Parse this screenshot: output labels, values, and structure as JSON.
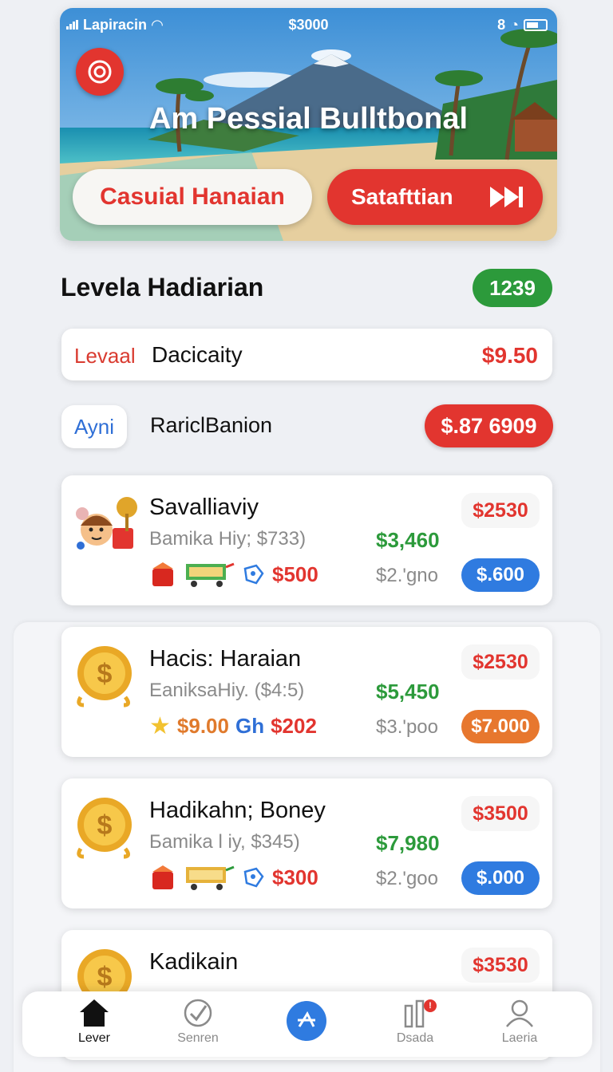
{
  "status_bar": {
    "carrier": "Lapiracin",
    "balance": "$3000",
    "time_prefix": "8"
  },
  "hero": {
    "title": "Am Pessial Bulltbonal",
    "casual_button": "Casuial Hanaian",
    "start_button": "Satafttian"
  },
  "section": {
    "title": "Levela Hadiarian",
    "badge": "1239"
  },
  "row1": {
    "label": "Levaal",
    "text": "Dacicaity",
    "price": "$9.50"
  },
  "row2": {
    "chip": "Ayni",
    "text": "RariclBanion",
    "badge": "$.87 6909"
  },
  "cards": [
    {
      "name": "Savalliaviy",
      "sub": "Bamika Hiy; $733)",
      "mid": "$3,460",
      "tag": "$2530",
      "icon_price_1": "",
      "icon_price_2": "",
      "icon_price_3": "$500",
      "low": "$2.'gno",
      "pill": "$.600",
      "pill_color": "#2f7be0"
    },
    {
      "name": "Hacis: Haraian",
      "sub": "EaniksaHiy. ($4:5)",
      "mid": "$5,450",
      "tag": "$2530",
      "icon_price_1": "$9.00",
      "icon_price_2": "Gh",
      "icon_price_3": "$202",
      "low": "$3.'poo",
      "pill": "$7.000",
      "pill_color": "#e7772e"
    },
    {
      "name": "Hadikahn; Boney",
      "sub": "Бamika l iy, $345)",
      "mid": "$7,980",
      "tag": "$3500",
      "icon_price_1": "",
      "icon_price_2": "",
      "icon_price_3": "$300",
      "low": "$2.'goo",
      "pill": "$.000",
      "pill_color": "#2f7be0"
    },
    {
      "name": "Kadikain",
      "sub": "",
      "mid": "",
      "tag": "$3530",
      "icon_price_1": "",
      "icon_price_2": "",
      "icon_price_3": "",
      "low": "",
      "pill": "",
      "pill_color": "#2f7be0"
    }
  ],
  "nav": {
    "items": [
      "Lever",
      "Senren",
      "Dsada",
      "Laeria"
    ],
    "notification": "!"
  },
  "colors": {
    "accent_red": "#e2352f",
    "green": "#2c9a3b",
    "blue": "#2f7be0",
    "orange": "#e7772e"
  }
}
